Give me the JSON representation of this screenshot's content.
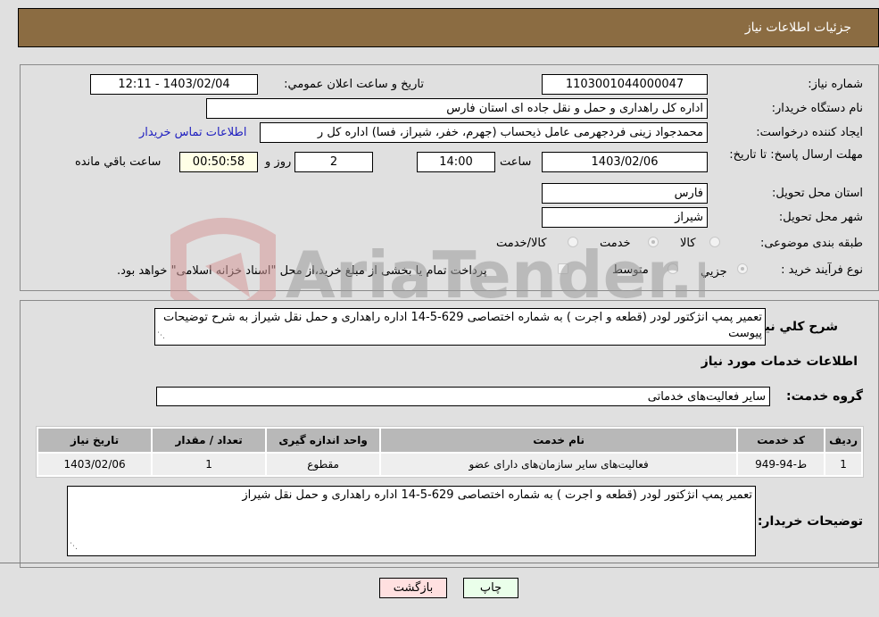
{
  "header": {
    "title": "جزئیات اطلاعات نیاز"
  },
  "form": {
    "need_number": {
      "label": "شماره نیاز:",
      "value": "1103001044000047"
    },
    "announce_datetime": {
      "label": "تاریخ و ساعت اعلان عمومي:",
      "value": "1403/02/04 - 12:11"
    },
    "buyer_org": {
      "label": "نام دستگاه خريدار:",
      "value": "اداره کل راهداری و حمل و نقل جاده ای استان فارس"
    },
    "requester": {
      "label": "ايجاد کننده درخواست:",
      "value": "محمدجواد زینی فردجهرمی عامل ذیحساب (جهرم، خفر، شیراز، فسا) اداره کل ر",
      "contact_link": "اطلاعات تماس خريدار"
    },
    "deadline": {
      "label": "مهلت ارسال پاسخ: تا تاریخ:",
      "date": "1403/02/06",
      "time_label": "ساعت",
      "time": "14:00",
      "days": "2",
      "days_label": "روز و",
      "remaining": "00:50:58",
      "remaining_label": "ساعت باقي مانده"
    },
    "delivery_province": {
      "label": "استان محل تحويل:",
      "value": "فارس"
    },
    "delivery_city": {
      "label": "شهر محل تحويل:",
      "value": "شیراز"
    },
    "category": {
      "label": "طبقه بندی موضوعی:",
      "options": [
        {
          "label": "کالا",
          "checked": false
        },
        {
          "label": "خدمت",
          "checked": true
        },
        {
          "label": "کالا/خدمت",
          "checked": false
        }
      ]
    },
    "purchase_type": {
      "label": "نوع فرآيند خريد :",
      "options": [
        {
          "label": "جزيي",
          "checked": true
        },
        {
          "label": "متوسط",
          "checked": false
        }
      ],
      "treasury_note": "پرداخت تمام يا بخشی از مبلغ خريد،از محل \"اسناد خزانه اسلامی\" خواهد بود."
    }
  },
  "details": {
    "summary_label": "شرح كلي نياز:",
    "summary_value": "تعمیر پمپ انژکتور لودر (قطعه و اجرت ) به شماره اختصاصی 629-5-14 اداره راهداری و حمل نقل شیراز به شرح توضیحات پیوست",
    "services_heading": "اطلاعات خدمات مورد نياز",
    "service_group_label": "گروه خدمت:",
    "service_group_value": "سایر فعالیت‌های خدماتی",
    "table": {
      "headers": [
        "رديف",
        "كد خدمت",
        "نام خدمت",
        "واحد اندازه گيری",
        "تعداد / مقدار",
        "تاريخ نياز"
      ],
      "rows": [
        [
          "1",
          "ط-94-949",
          "فعالیت‌های سایر سازمان‌های دارای عضو",
          "مقطوع",
          "1",
          "1403/02/06"
        ]
      ]
    },
    "buyer_notes_label": "توضيحات خريدار:",
    "buyer_notes_value": "تعمیر پمپ انژکتور لودر (قطعه و اجرت ) به شماره اختصاصی 629-5-14 اداره راهداری و حمل نقل شیراز"
  },
  "buttons": {
    "print": "چاپ",
    "back": "بازگشت"
  },
  "colors": {
    "header_bg": "#8b6c42",
    "print_bg": "#eaffea",
    "back_bg": "#ffe0e0",
    "link": "#2020c0"
  }
}
